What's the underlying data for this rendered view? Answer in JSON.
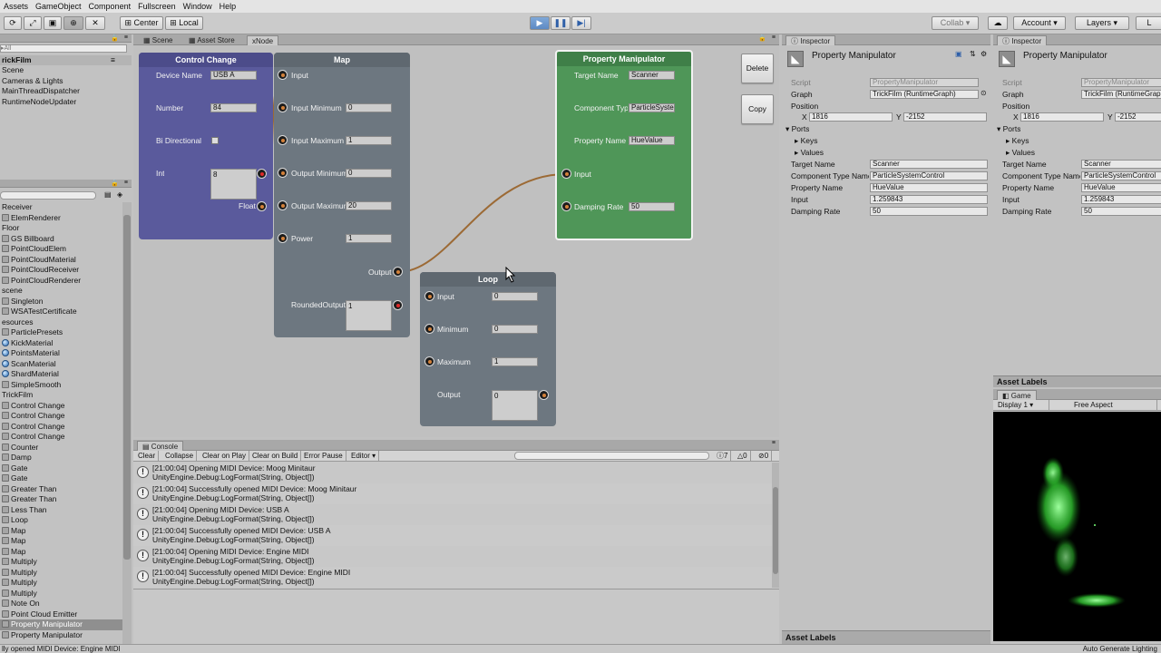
{
  "menu": [
    "Assets",
    "GameObject",
    "Component",
    "Fullscreen",
    "Window",
    "Help"
  ],
  "toolbar": {
    "pivot": "Center",
    "space": "Local",
    "collab": "Collab ▾",
    "account": "Account ▾",
    "layers": "Layers ▾"
  },
  "hierarchy": {
    "search_placeholder": "▸All",
    "scene_title": "rickFilm",
    "scene_items": [
      "Scene",
      "Cameras & Lights",
      "MainThreadDispatcher",
      "RuntimeNodeUpdater"
    ]
  },
  "project": {
    "items": [
      {
        "label": "Receiver",
        "icon": "none"
      },
      {
        "label": "ElemRenderer",
        "icon": "script"
      },
      {
        "label": "Floor",
        "icon": "none"
      },
      {
        "label": "GS Billboard",
        "icon": "script"
      },
      {
        "label": "PointCloudElem",
        "icon": "script"
      },
      {
        "label": "PointCloudMaterial",
        "icon": "script"
      },
      {
        "label": "PointCloudReceiver",
        "icon": "script"
      },
      {
        "label": "PointCloudRenderer",
        "icon": "script"
      },
      {
        "label": "scene",
        "icon": "none"
      },
      {
        "label": "Singleton",
        "icon": "script"
      },
      {
        "label": "WSATestCertificate",
        "icon": "script"
      },
      {
        "label": "esources",
        "icon": "none"
      },
      {
        "label": "ParticlePresets",
        "icon": "folder"
      },
      {
        "label": "KickMaterial",
        "icon": "sphere"
      },
      {
        "label": "PointsMaterial",
        "icon": "sphere"
      },
      {
        "label": "ScanMaterial",
        "icon": "sphere"
      },
      {
        "label": "ShardMaterial",
        "icon": "sphere"
      },
      {
        "label": "SimpleSmooth",
        "icon": "script"
      },
      {
        "label": "TrickFilm",
        "icon": "none"
      },
      {
        "label": "Control Change",
        "icon": "node"
      },
      {
        "label": "Control Change",
        "icon": "node"
      },
      {
        "label": "Control Change",
        "icon": "node"
      },
      {
        "label": "Control Change",
        "icon": "node"
      },
      {
        "label": "Counter",
        "icon": "node"
      },
      {
        "label": "Damp",
        "icon": "node"
      },
      {
        "label": "Gate",
        "icon": "node"
      },
      {
        "label": "Gate",
        "icon": "node"
      },
      {
        "label": "Greater Than",
        "icon": "node"
      },
      {
        "label": "Greater Than",
        "icon": "node"
      },
      {
        "label": "Less Than",
        "icon": "node"
      },
      {
        "label": "Loop",
        "icon": "node"
      },
      {
        "label": "Map",
        "icon": "node"
      },
      {
        "label": "Map",
        "icon": "node"
      },
      {
        "label": "Map",
        "icon": "node"
      },
      {
        "label": "Multiply",
        "icon": "node"
      },
      {
        "label": "Multiply",
        "icon": "node"
      },
      {
        "label": "Multiply",
        "icon": "node"
      },
      {
        "label": "Multiply",
        "icon": "node"
      },
      {
        "label": "Note On",
        "icon": "node"
      },
      {
        "label": "Point Cloud Emitter",
        "icon": "node"
      },
      {
        "label": "Property Manipulator",
        "icon": "node",
        "selected": true
      },
      {
        "label": "Property Manipulator",
        "icon": "node"
      }
    ]
  },
  "scene_tabs": [
    "Scene",
    "Asset Store",
    "xNode"
  ],
  "graph": {
    "delete_label": "Delete",
    "copy_label": "Copy",
    "control_change": {
      "title": "Control Change",
      "device_label": "Device Name",
      "device_value": "USB A",
      "number_label": "Number",
      "number_value": "84",
      "bidir_label": "Bi Directional",
      "int_label": "Int",
      "int_value": "8",
      "float_label": "Float"
    },
    "map": {
      "title": "Map",
      "rows": [
        {
          "label": "Input",
          "value": ""
        },
        {
          "label": "Input Minimum",
          "value": "0"
        },
        {
          "label": "Input Maximum",
          "value": "1"
        },
        {
          "label": "Output Minimum",
          "value": "0"
        },
        {
          "label": "Output Maximum",
          "value": "20"
        },
        {
          "label": "Power",
          "value": "1"
        }
      ],
      "output_label": "Output",
      "rounded_label": "RoundedOutput",
      "rounded_value": "1"
    },
    "property_manipulator": {
      "title": "Property Manipulator",
      "target_label": "Target Name",
      "target_value": "Scanner",
      "component_label": "Component Type",
      "component_value": "ParticleSystemControl",
      "property_label": "Property Name",
      "property_value": "HueValue",
      "input_label": "Input",
      "damping_label": "Damping Rate",
      "damping_value": "50"
    },
    "loop": {
      "title": "Loop",
      "rows": [
        {
          "label": "Input",
          "value": "0"
        },
        {
          "label": "Minimum",
          "value": "0"
        },
        {
          "label": "Maximum",
          "value": "1"
        }
      ],
      "output_label": "Output",
      "output_value": "0"
    }
  },
  "console": {
    "tab": "Console",
    "buttons": [
      "Clear",
      "Collapse",
      "Clear on Play",
      "Clear on Build",
      "Error Pause",
      "Editor ▾"
    ],
    "counts": {
      "info": "7",
      "warn": "0",
      "error": "0"
    },
    "entries": [
      {
        "line1": "[21:00:04] Opening MIDI Device: Moog Minitaur",
        "line2": "UnityEngine.Debug:LogFormat(String, Object[])"
      },
      {
        "line1": "[21:00:04] Successfully opened MIDI Device: Moog Minitaur",
        "line2": "UnityEngine.Debug:LogFormat(String, Object[])"
      },
      {
        "line1": "[21:00:04] Opening MIDI Device: USB A",
        "line2": "UnityEngine.Debug:LogFormat(String, Object[])"
      },
      {
        "line1": "[21:00:04] Successfully opened MIDI Device: USB A",
        "line2": "UnityEngine.Debug:LogFormat(String, Object[])"
      },
      {
        "line1": "[21:00:04] Opening MIDI Device: Engine MIDI",
        "line2": "UnityEngine.Debug:LogFormat(String, Object[])"
      },
      {
        "line1": "[21:00:04] Successfully opened MIDI Device: Engine MIDI",
        "line2": "UnityEngine.Debug:LogFormat(String, Object[])"
      }
    ]
  },
  "inspector": {
    "tab": "Inspector",
    "title": "Property Manipulator",
    "script_label": "Script",
    "script_value": "PropertyManipulator",
    "graph_label": "Graph",
    "graph_value": "TrickFilm (RuntimeGraph)",
    "position_label": "Position",
    "pos_x": "1816",
    "pos_y": "-2152",
    "ports_label": "Ports",
    "keys_label": "Keys",
    "values_label": "Values",
    "target_label": "Target Name",
    "target_value": "Scanner",
    "component_label": "Component Type Name",
    "component_value": "ParticleSystemControl",
    "property_label": "Property Name",
    "property_value": "HueValue",
    "input_label": "Input",
    "input_value": "1.259843",
    "damping_label": "Damping Rate",
    "damping_value": "50",
    "asset_labels": "Asset Labels"
  },
  "game": {
    "tab": "Game",
    "display": "Display 1",
    "aspect": "Free Aspect"
  },
  "status": {
    "message": "lly opened MIDI Device: Engine MIDI",
    "right": "Auto Generate Lighting"
  },
  "colors": {
    "control_change": "#5a5a9c",
    "map": "#6d7780",
    "property_manipulator": "#4f9658",
    "loop": "#6d7780",
    "wire": "#9c6a35"
  }
}
